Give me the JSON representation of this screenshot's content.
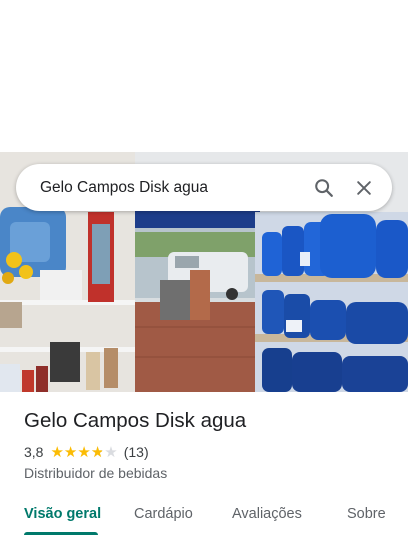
{
  "search": {
    "query": "Gelo Campos Disk agua"
  },
  "place": {
    "name": "Gelo Campos Disk agua",
    "rating": "3,8",
    "rating_value": 3.8,
    "review_count": "(13)",
    "category": "Distribuidor de bebidas"
  },
  "tabs": [
    {
      "label": "Visão geral",
      "active": true
    },
    {
      "label": "Cardápio",
      "active": false
    },
    {
      "label": "Avaliações",
      "active": false
    },
    {
      "label": "Sobre",
      "active": false
    }
  ],
  "colors": {
    "accent": "#00796b",
    "star": "#fbbc04",
    "star_empty": "#dadce0"
  },
  "icons": [
    "search-icon",
    "close-icon",
    "star-icon"
  ]
}
